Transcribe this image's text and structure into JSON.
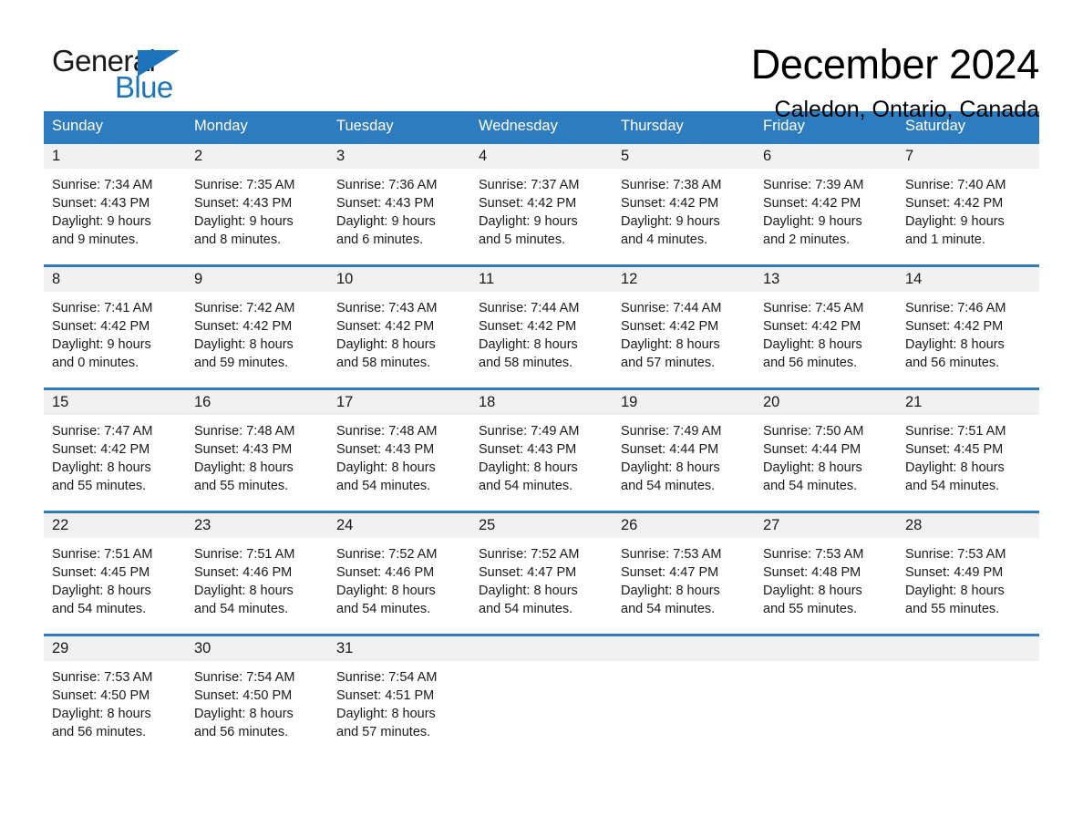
{
  "brand": {
    "name_part1": "General",
    "name_part2": "Blue",
    "accent_color": "#1c75bc",
    "triangle_icon": "triangle-icon"
  },
  "header": {
    "title": "December 2024",
    "location": "Caledon, Ontario, Canada"
  },
  "theme": {
    "header_band": "#2e7cc0",
    "date_band": "#f1f1f1",
    "text": "#1a1a1a"
  },
  "weekdays": [
    "Sunday",
    "Monday",
    "Tuesday",
    "Wednesday",
    "Thursday",
    "Friday",
    "Saturday"
  ],
  "weeks": [
    [
      {
        "day": "1",
        "sunrise": "Sunrise: 7:34 AM",
        "sunset": "Sunset: 4:43 PM",
        "daylight_line1": "Daylight: 9 hours",
        "daylight_line2": "and 9 minutes."
      },
      {
        "day": "2",
        "sunrise": "Sunrise: 7:35 AM",
        "sunset": "Sunset: 4:43 PM",
        "daylight_line1": "Daylight: 9 hours",
        "daylight_line2": "and 8 minutes."
      },
      {
        "day": "3",
        "sunrise": "Sunrise: 7:36 AM",
        "sunset": "Sunset: 4:43 PM",
        "daylight_line1": "Daylight: 9 hours",
        "daylight_line2": "and 6 minutes."
      },
      {
        "day": "4",
        "sunrise": "Sunrise: 7:37 AM",
        "sunset": "Sunset: 4:42 PM",
        "daylight_line1": "Daylight: 9 hours",
        "daylight_line2": "and 5 minutes."
      },
      {
        "day": "5",
        "sunrise": "Sunrise: 7:38 AM",
        "sunset": "Sunset: 4:42 PM",
        "daylight_line1": "Daylight: 9 hours",
        "daylight_line2": "and 4 minutes."
      },
      {
        "day": "6",
        "sunrise": "Sunrise: 7:39 AM",
        "sunset": "Sunset: 4:42 PM",
        "daylight_line1": "Daylight: 9 hours",
        "daylight_line2": "and 2 minutes."
      },
      {
        "day": "7",
        "sunrise": "Sunrise: 7:40 AM",
        "sunset": "Sunset: 4:42 PM",
        "daylight_line1": "Daylight: 9 hours",
        "daylight_line2": "and 1 minute."
      }
    ],
    [
      {
        "day": "8",
        "sunrise": "Sunrise: 7:41 AM",
        "sunset": "Sunset: 4:42 PM",
        "daylight_line1": "Daylight: 9 hours",
        "daylight_line2": "and 0 minutes."
      },
      {
        "day": "9",
        "sunrise": "Sunrise: 7:42 AM",
        "sunset": "Sunset: 4:42 PM",
        "daylight_line1": "Daylight: 8 hours",
        "daylight_line2": "and 59 minutes."
      },
      {
        "day": "10",
        "sunrise": "Sunrise: 7:43 AM",
        "sunset": "Sunset: 4:42 PM",
        "daylight_line1": "Daylight: 8 hours",
        "daylight_line2": "and 58 minutes."
      },
      {
        "day": "11",
        "sunrise": "Sunrise: 7:44 AM",
        "sunset": "Sunset: 4:42 PM",
        "daylight_line1": "Daylight: 8 hours",
        "daylight_line2": "and 58 minutes."
      },
      {
        "day": "12",
        "sunrise": "Sunrise: 7:44 AM",
        "sunset": "Sunset: 4:42 PM",
        "daylight_line1": "Daylight: 8 hours",
        "daylight_line2": "and 57 minutes."
      },
      {
        "day": "13",
        "sunrise": "Sunrise: 7:45 AM",
        "sunset": "Sunset: 4:42 PM",
        "daylight_line1": "Daylight: 8 hours",
        "daylight_line2": "and 56 minutes."
      },
      {
        "day": "14",
        "sunrise": "Sunrise: 7:46 AM",
        "sunset": "Sunset: 4:42 PM",
        "daylight_line1": "Daylight: 8 hours",
        "daylight_line2": "and 56 minutes."
      }
    ],
    [
      {
        "day": "15",
        "sunrise": "Sunrise: 7:47 AM",
        "sunset": "Sunset: 4:42 PM",
        "daylight_line1": "Daylight: 8 hours",
        "daylight_line2": "and 55 minutes."
      },
      {
        "day": "16",
        "sunrise": "Sunrise: 7:48 AM",
        "sunset": "Sunset: 4:43 PM",
        "daylight_line1": "Daylight: 8 hours",
        "daylight_line2": "and 55 minutes."
      },
      {
        "day": "17",
        "sunrise": "Sunrise: 7:48 AM",
        "sunset": "Sunset: 4:43 PM",
        "daylight_line1": "Daylight: 8 hours",
        "daylight_line2": "and 54 minutes."
      },
      {
        "day": "18",
        "sunrise": "Sunrise: 7:49 AM",
        "sunset": "Sunset: 4:43 PM",
        "daylight_line1": "Daylight: 8 hours",
        "daylight_line2": "and 54 minutes."
      },
      {
        "day": "19",
        "sunrise": "Sunrise: 7:49 AM",
        "sunset": "Sunset: 4:44 PM",
        "daylight_line1": "Daylight: 8 hours",
        "daylight_line2": "and 54 minutes."
      },
      {
        "day": "20",
        "sunrise": "Sunrise: 7:50 AM",
        "sunset": "Sunset: 4:44 PM",
        "daylight_line1": "Daylight: 8 hours",
        "daylight_line2": "and 54 minutes."
      },
      {
        "day": "21",
        "sunrise": "Sunrise: 7:51 AM",
        "sunset": "Sunset: 4:45 PM",
        "daylight_line1": "Daylight: 8 hours",
        "daylight_line2": "and 54 minutes."
      }
    ],
    [
      {
        "day": "22",
        "sunrise": "Sunrise: 7:51 AM",
        "sunset": "Sunset: 4:45 PM",
        "daylight_line1": "Daylight: 8 hours",
        "daylight_line2": "and 54 minutes."
      },
      {
        "day": "23",
        "sunrise": "Sunrise: 7:51 AM",
        "sunset": "Sunset: 4:46 PM",
        "daylight_line1": "Daylight: 8 hours",
        "daylight_line2": "and 54 minutes."
      },
      {
        "day": "24",
        "sunrise": "Sunrise: 7:52 AM",
        "sunset": "Sunset: 4:46 PM",
        "daylight_line1": "Daylight: 8 hours",
        "daylight_line2": "and 54 minutes."
      },
      {
        "day": "25",
        "sunrise": "Sunrise: 7:52 AM",
        "sunset": "Sunset: 4:47 PM",
        "daylight_line1": "Daylight: 8 hours",
        "daylight_line2": "and 54 minutes."
      },
      {
        "day": "26",
        "sunrise": "Sunrise: 7:53 AM",
        "sunset": "Sunset: 4:47 PM",
        "daylight_line1": "Daylight: 8 hours",
        "daylight_line2": "and 54 minutes."
      },
      {
        "day": "27",
        "sunrise": "Sunrise: 7:53 AM",
        "sunset": "Sunset: 4:48 PM",
        "daylight_line1": "Daylight: 8 hours",
        "daylight_line2": "and 55 minutes."
      },
      {
        "day": "28",
        "sunrise": "Sunrise: 7:53 AM",
        "sunset": "Sunset: 4:49 PM",
        "daylight_line1": "Daylight: 8 hours",
        "daylight_line2": "and 55 minutes."
      }
    ],
    [
      {
        "day": "29",
        "sunrise": "Sunrise: 7:53 AM",
        "sunset": "Sunset: 4:50 PM",
        "daylight_line1": "Daylight: 8 hours",
        "daylight_line2": "and 56 minutes."
      },
      {
        "day": "30",
        "sunrise": "Sunrise: 7:54 AM",
        "sunset": "Sunset: 4:50 PM",
        "daylight_line1": "Daylight: 8 hours",
        "daylight_line2": "and 56 minutes."
      },
      {
        "day": "31",
        "sunrise": "Sunrise: 7:54 AM",
        "sunset": "Sunset: 4:51 PM",
        "daylight_line1": "Daylight: 8 hours",
        "daylight_line2": "and 57 minutes."
      },
      {
        "day": "",
        "sunrise": "",
        "sunset": "",
        "daylight_line1": "",
        "daylight_line2": ""
      },
      {
        "day": "",
        "sunrise": "",
        "sunset": "",
        "daylight_line1": "",
        "daylight_line2": ""
      },
      {
        "day": "",
        "sunrise": "",
        "sunset": "",
        "daylight_line1": "",
        "daylight_line2": ""
      },
      {
        "day": "",
        "sunrise": "",
        "sunset": "",
        "daylight_line1": "",
        "daylight_line2": ""
      }
    ]
  ]
}
